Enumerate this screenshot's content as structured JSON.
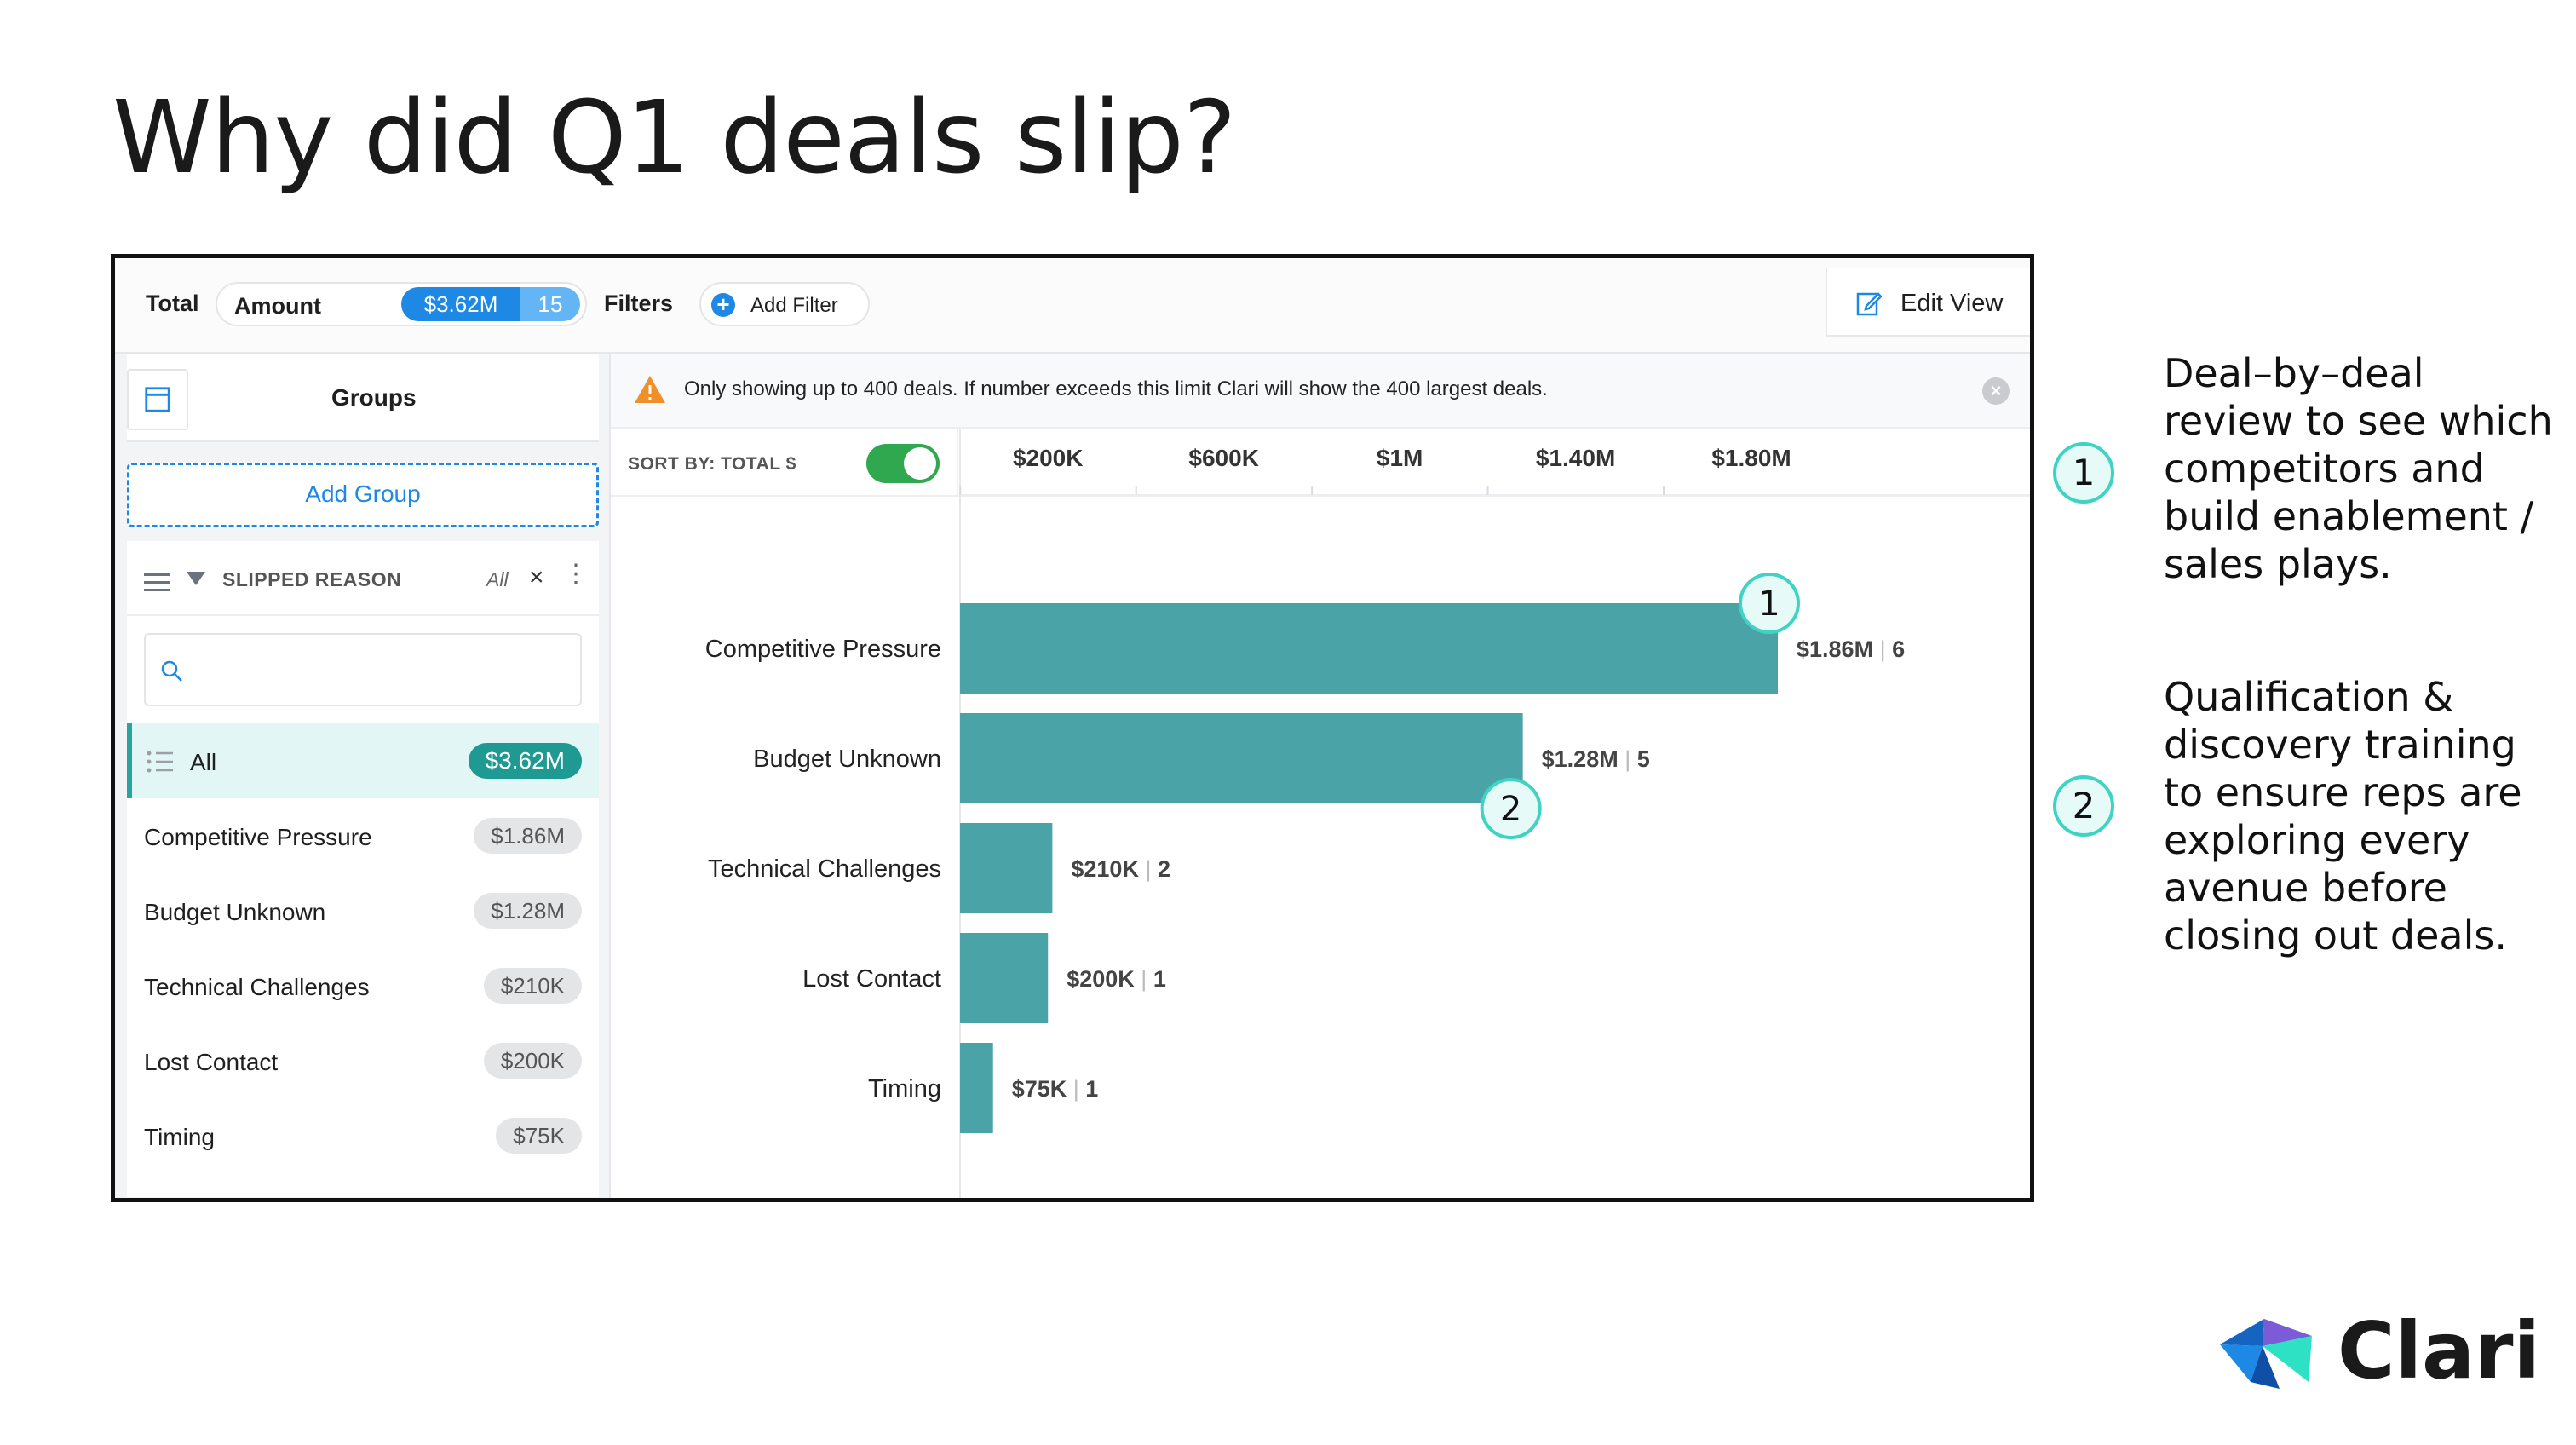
{
  "slide": {
    "title": "Why did Q1 deals slip?"
  },
  "toolbar": {
    "total_label": "Total",
    "amount_label": "Amount",
    "amount_value": "$3.62M",
    "amount_count": "15",
    "filters_label": "Filters",
    "add_filter_label": "Add Filter",
    "edit_view_label": "Edit View"
  },
  "sidebar": {
    "groups_title": "Groups",
    "add_group_label": "Add Group",
    "filter": {
      "label": "SLIPPED REASON",
      "scope": "All",
      "close": "×",
      "more": "⋮"
    },
    "items": [
      {
        "label": "All",
        "value": "$3.62M",
        "active": true
      },
      {
        "label": "Competitive Pressure",
        "value": "$1.86M"
      },
      {
        "label": "Budget Unknown",
        "value": "$1.28M"
      },
      {
        "label": "Technical Challenges",
        "value": "$210K"
      },
      {
        "label": "Lost Contact",
        "value": "$200K"
      },
      {
        "label": "Timing",
        "value": "$75K"
      }
    ]
  },
  "main": {
    "notice": "Only showing up to 400 deals. If number exceeds this limit Clari will show the 400 largest deals.",
    "notice_close": "×",
    "sort_label": "SORT BY: TOTAL $",
    "sort_enabled": true
  },
  "chart_data": {
    "type": "bar",
    "orientation": "horizontal",
    "categories": [
      "Competitive Pressure",
      "Budget Unknown",
      "Technical Challenges",
      "Lost Contact",
      "Timing"
    ],
    "values": [
      1860000,
      1280000,
      210000,
      200000,
      75000
    ],
    "value_labels": [
      "$1.86M",
      "$1.28M",
      "$210K",
      "$200K",
      "$75K"
    ],
    "counts": [
      6,
      5,
      2,
      1,
      1
    ],
    "tick_values": [
      200000,
      600000,
      1000000,
      1400000,
      1800000
    ],
    "tick_labels": [
      "$200K",
      "$600K",
      "$1M",
      "$1.40M",
      "$1.80M"
    ],
    "xlim": [
      0,
      2400000
    ],
    "bar_color": "#4aa3a6",
    "callouts": [
      {
        "number": "1",
        "category": "Competitive Pressure"
      },
      {
        "number": "2",
        "category": "Budget Unknown"
      }
    ]
  },
  "annotations": [
    {
      "number": "1",
      "text": "Deal–by–deal review to see which competitors and build enablement / sales plays."
    },
    {
      "number": "2",
      "text": "Qualification & discovery training to ensure reps are exploring every avenue before closing out deals."
    }
  ],
  "brand": {
    "logo_text": "Clari",
    "accent_color": "#3fd3c4"
  }
}
